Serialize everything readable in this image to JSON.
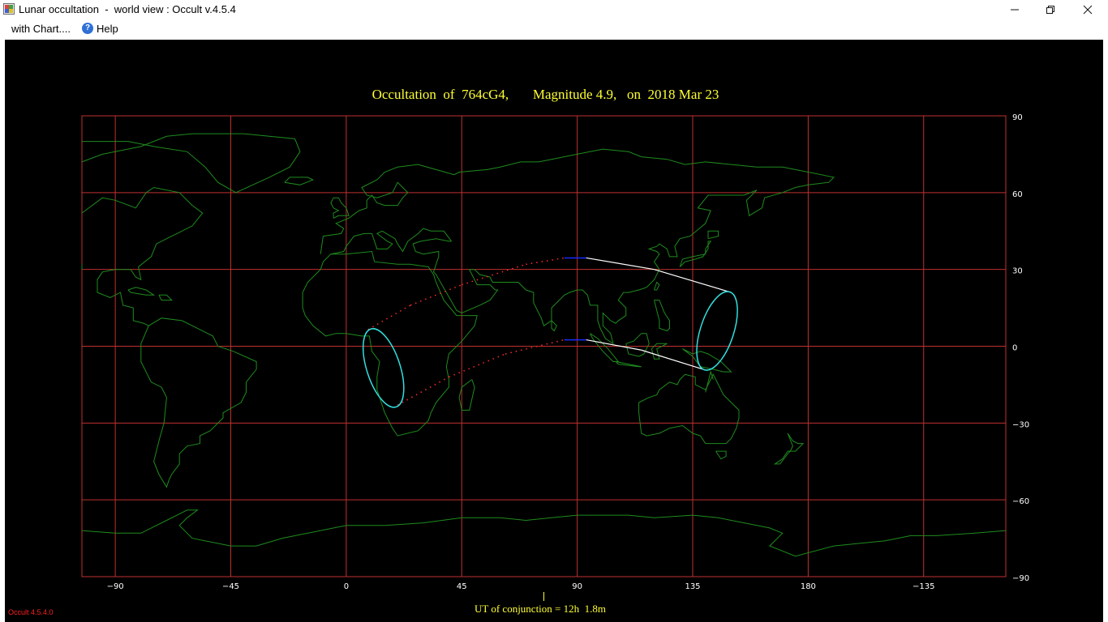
{
  "window": {
    "title": "Lunar occultation  -  world view : Occult v.4.5.4",
    "minimize_icon": "minimize-icon",
    "restore_icon": "restore-icon",
    "close_icon": "close-icon"
  },
  "menu": {
    "items": [
      {
        "label": "with Chart...."
      },
      {
        "label": "Help",
        "icon": "help-icon"
      }
    ]
  },
  "colors": {
    "background": "#000000",
    "grid": "#c03030",
    "coastline": "#1e8c1e",
    "title_text": "#ffff33",
    "axis_text": "#ffffff",
    "limits_graze": "#ffffff",
    "limits_night": "#1a2bff",
    "limits_daylight": "#ff2a2a",
    "rise_set_curve": "#33dddd"
  },
  "chart_data": {
    "type": "map",
    "title": "Occultation  of  764cG4,       Magnitude 4.9,   on  2018 Mar 23",
    "projection": "equirectangular",
    "x_ticks": [
      -90,
      -45,
      0,
      45,
      90,
      135,
      180,
      -135
    ],
    "x_tick_labels": [
      "−90",
      "−45",
      "0",
      "45",
      "90",
      "135",
      "180",
      "−135"
    ],
    "y_ticks": [
      90,
      60,
      30,
      0,
      -30,
      -60,
      -90
    ],
    "y_tick_labels": [
      "90",
      "60",
      "30",
      "0",
      "−30",
      "−60",
      "−90"
    ],
    "lon_range": [
      -103,
      257
    ],
    "lat_range": [
      -90,
      90
    ],
    "grid": true,
    "occultation_limits": {
      "north_limit": [
        {
          "lon": 8.5,
          "lat": 6.5,
          "style": "daylight"
        },
        {
          "lon": 25,
          "lat": 16,
          "style": "daylight"
        },
        {
          "lon": 45,
          "lat": 24,
          "style": "daylight"
        },
        {
          "lon": 70,
          "lat": 32,
          "style": "daylight"
        },
        {
          "lon": 85,
          "lat": 34.5,
          "style": "night"
        },
        {
          "lon": 93.5,
          "lat": 34.5,
          "style": "graze"
        },
        {
          "lon": 120,
          "lat": 30,
          "style": "graze"
        },
        {
          "lon": 150,
          "lat": 21,
          "style": "graze"
        }
      ],
      "south_limit": [
        {
          "lon": 20,
          "lat": -23,
          "style": "daylight"
        },
        {
          "lon": 40,
          "lat": -12,
          "style": "daylight"
        },
        {
          "lon": 62,
          "lat": -3,
          "style": "daylight"
        },
        {
          "lon": 85,
          "lat": 2.5,
          "style": "night"
        },
        {
          "lon": 93.5,
          "lat": 2.5,
          "style": "graze"
        },
        {
          "lon": 115,
          "lat": -1.5,
          "style": "graze"
        },
        {
          "lon": 139,
          "lat": -9,
          "style": "graze"
        }
      ],
      "rise_set_ellipses": [
        {
          "center_lon": 14.5,
          "center_lat": -8.5,
          "semi_axis_lon": 6.5,
          "semi_axis_lat": 16,
          "rotation_deg": -18
        },
        {
          "center_lon": 144.5,
          "center_lat": 6,
          "semi_axis_lon": 6.5,
          "semi_axis_lat": 16,
          "rotation_deg": 18
        }
      ]
    },
    "conjunction_lon": 77,
    "footer": "UT of conjunction = 12h  1.8m"
  },
  "version_label": "Occult 4.5.4.0"
}
